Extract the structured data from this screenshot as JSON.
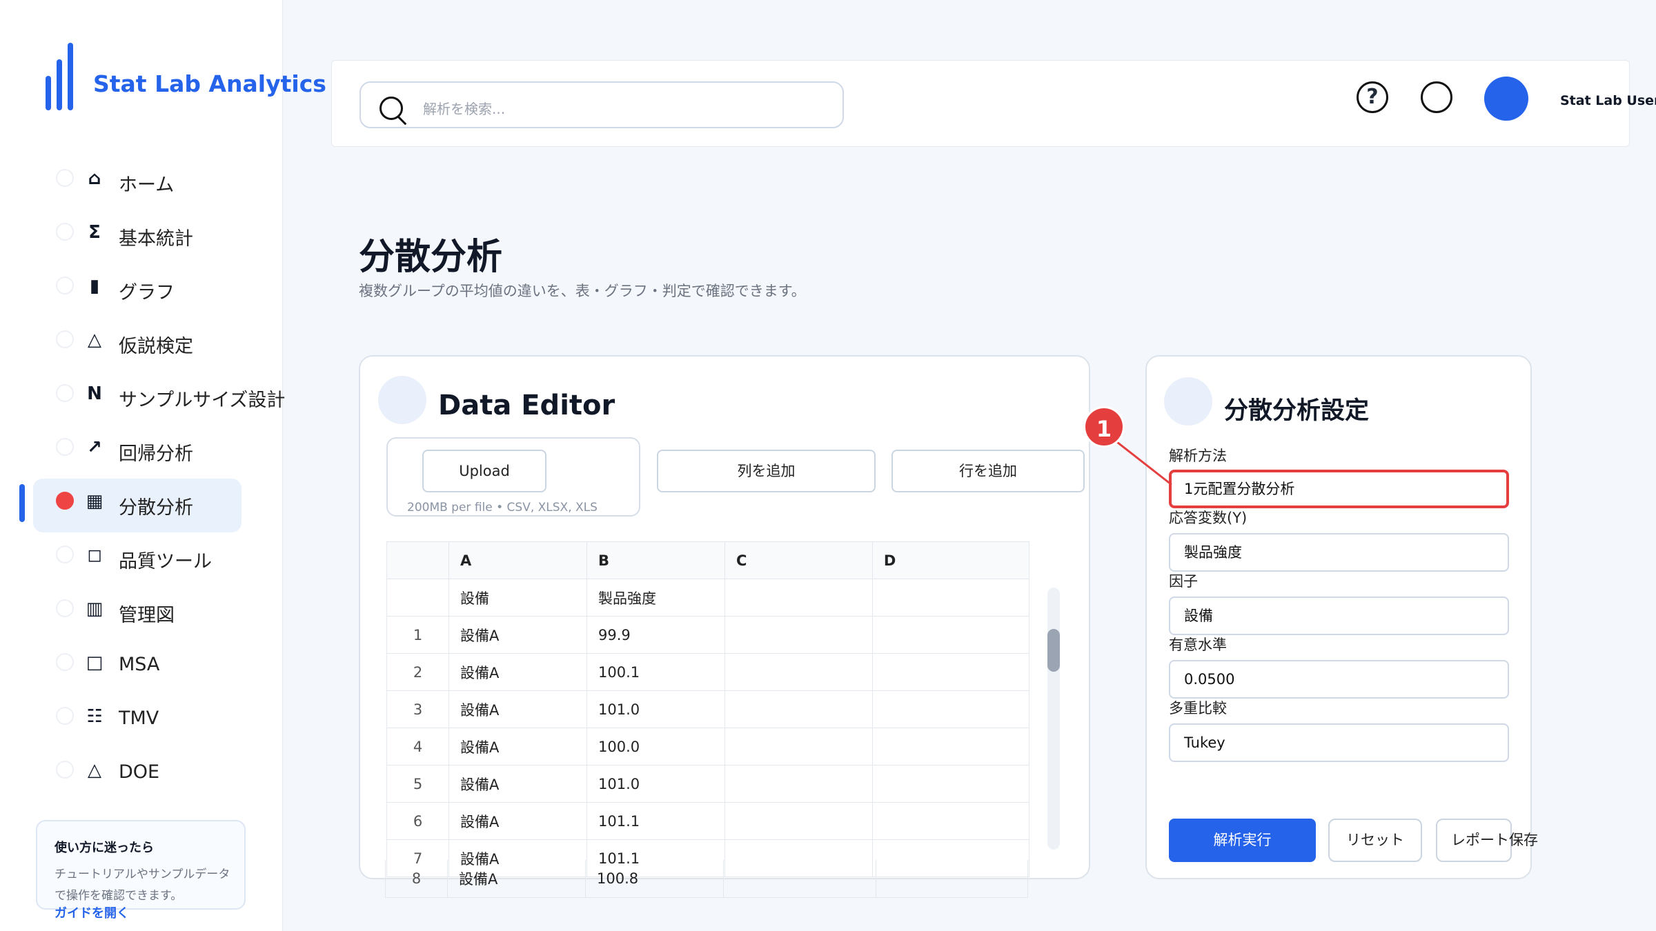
{
  "app": {
    "title": "Stat Lab Analytics"
  },
  "sidebar": {
    "items": [
      {
        "icon": "⌂",
        "label": "ホーム"
      },
      {
        "icon": "Σ",
        "label": "基本統計"
      },
      {
        "icon": "▮",
        "label": "グラフ"
      },
      {
        "icon": "△",
        "label": "仮説検定"
      },
      {
        "icon": "N",
        "label": "サンプルサイズ設計"
      },
      {
        "icon": "↗",
        "label": "回帰分析"
      },
      {
        "icon": "▦",
        "label": "分散分析"
      },
      {
        "icon": "◻",
        "label": "品質ツール"
      },
      {
        "icon": "▥",
        "label": "管理図"
      },
      {
        "icon": "□",
        "label": "MSA"
      },
      {
        "icon": "☷",
        "label": "TMV"
      },
      {
        "icon": "△",
        "label": "DOE"
      }
    ],
    "active_index": 6,
    "help": {
      "title": "使い方に迷ったら",
      "body": "チュートリアルやサンプルデータで操作を確認できます。",
      "link": "ガイドを開く"
    }
  },
  "header": {
    "search_placeholder": "解析を検索...",
    "help_icon": "?",
    "user_name": "Stat Lab User"
  },
  "page": {
    "title": "分散分析",
    "subtitle": "複数グループの平均値の違いを、表・グラフ・判定で確認できます。"
  },
  "editor": {
    "title": "Data Editor",
    "upload_label": "Upload",
    "upload_note": "200MB per file • CSV, XLSX, XLS",
    "add_column": "列を追加",
    "add_row": "行を追加",
    "columns": [
      "",
      "A",
      "B",
      "C",
      "D"
    ],
    "header_row": [
      "",
      "設備",
      "製品強度",
      "",
      ""
    ],
    "rows": [
      [
        "1",
        "設備A",
        "99.9",
        "",
        ""
      ],
      [
        "2",
        "設備A",
        "100.1",
        "",
        ""
      ],
      [
        "3",
        "設備A",
        "101.0",
        "",
        ""
      ],
      [
        "4",
        "設備A",
        "100.0",
        "",
        ""
      ],
      [
        "5",
        "設備A",
        "101.0",
        "",
        ""
      ],
      [
        "6",
        "設備A",
        "101.1",
        "",
        ""
      ],
      [
        "7",
        "設備A",
        "101.1",
        "",
        ""
      ]
    ],
    "overflow_rows": [
      [
        "8",
        "設備A",
        "100.8",
        "",
        ""
      ]
    ]
  },
  "settings": {
    "title": "分散分析設定",
    "method_label": "解析方法",
    "method_value": "1元配置分散分析",
    "response_label": "応答変数(Y)",
    "response_value": "製品強度",
    "factor_label": "因子",
    "factor_value": "設備",
    "alpha_label": "有意水準",
    "alpha_value": "0.0500",
    "multi_label": "多重比較",
    "multi_value": "Tukey",
    "run_label": "解析実行",
    "reset_label": "リセット",
    "save_label": "レポート保存"
  },
  "annotation": {
    "number": "1"
  },
  "colors": {
    "accent": "#2563eb",
    "highlight": "#e53e3e",
    "active_bg": "#e9f1fd"
  }
}
